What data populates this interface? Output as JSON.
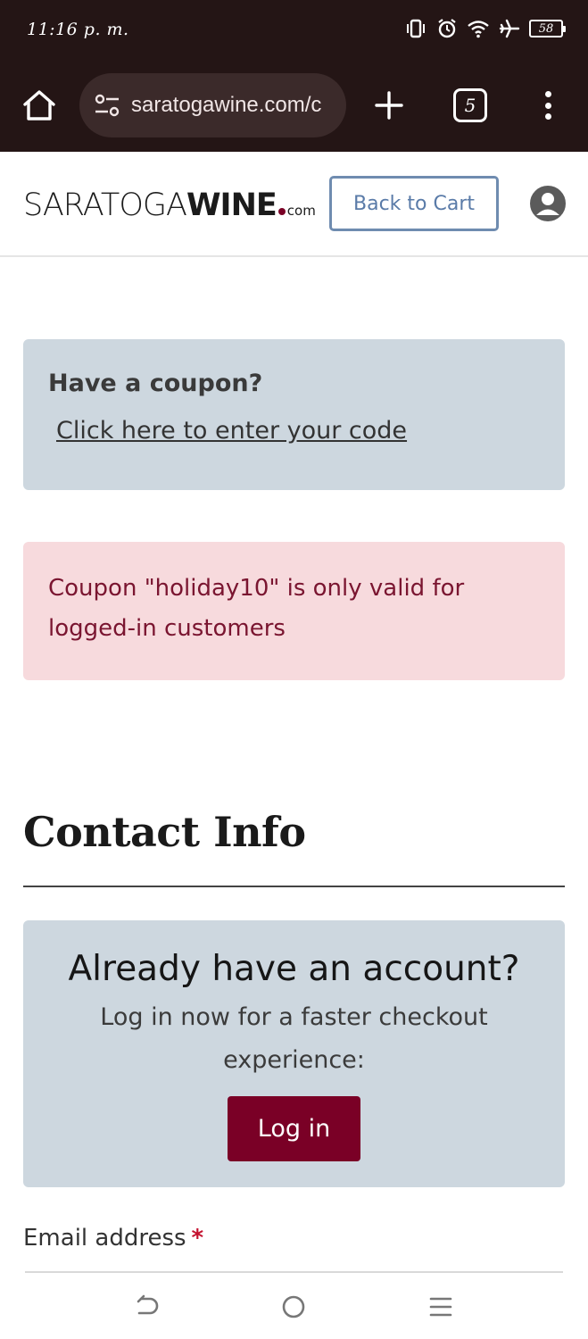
{
  "status_bar": {
    "time": "11:16 p. m.",
    "battery": "58"
  },
  "browser": {
    "url": "saratogawine.com/c",
    "tab_count": "5"
  },
  "header": {
    "logo_light": "SARATOGA",
    "logo_bold": "WINE",
    "logo_com": "com",
    "back_to_cart": "Back to Cart"
  },
  "coupon": {
    "title": "Have a coupon?",
    "link": "Click here to enter your code"
  },
  "error": {
    "message": "Coupon \"holiday10\" is only valid for logged-in customers"
  },
  "contact": {
    "heading": "Contact Info"
  },
  "login": {
    "title": "Already have an account?",
    "subtitle": "Log in now for a faster checkout experience:",
    "button": "Log in"
  },
  "email": {
    "label": "Email address",
    "required_mark": "*"
  },
  "colors": {
    "chrome_bg": "#241515",
    "brand": "#7a0026",
    "info_box": "#cdd7df",
    "error_box": "#f7dadd",
    "error_text": "#7a1530",
    "outline_button": "#6f8cb0"
  }
}
